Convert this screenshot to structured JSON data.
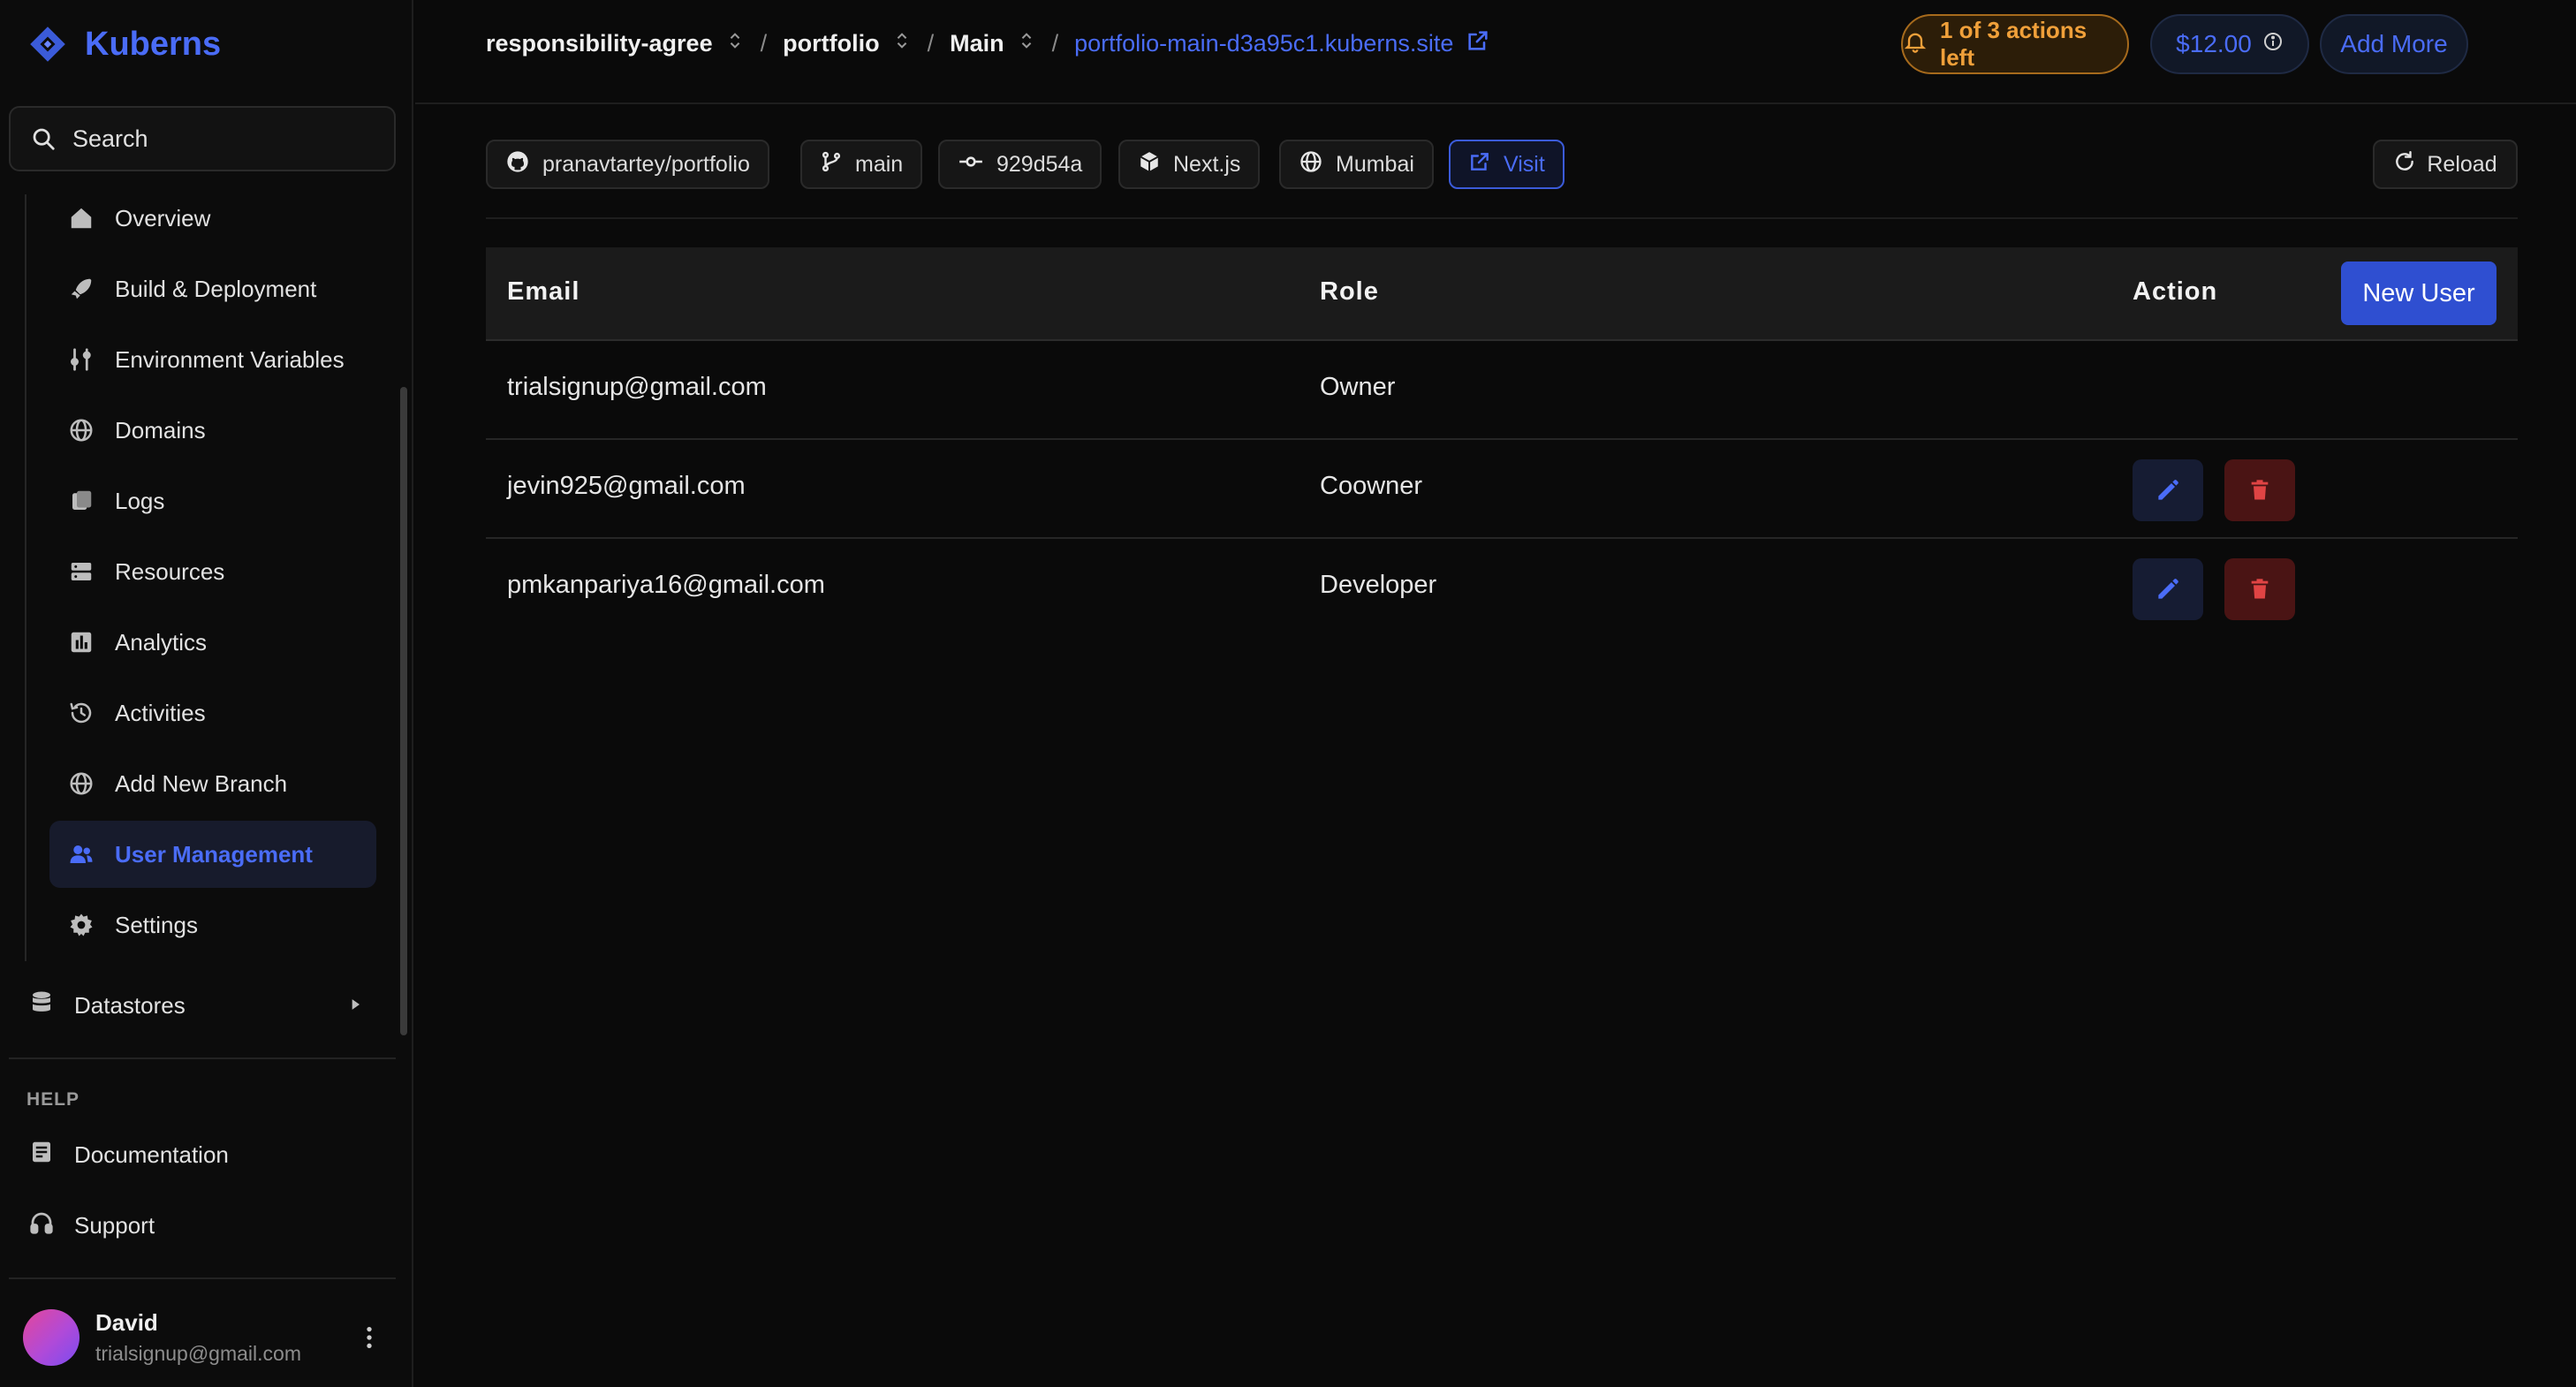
{
  "app": {
    "name": "Kuberns"
  },
  "search": {
    "label": "Search"
  },
  "sidebar": {
    "items": [
      {
        "label": "Overview",
        "icon": "home-icon"
      },
      {
        "label": "Build & Deployment",
        "icon": "rocket-icon"
      },
      {
        "label": "Environment Variables",
        "icon": "sliders-icon"
      },
      {
        "label": "Domains",
        "icon": "globe-icon"
      },
      {
        "label": "Logs",
        "icon": "logs-icon"
      },
      {
        "label": "Resources",
        "icon": "server-icon"
      },
      {
        "label": "Analytics",
        "icon": "bar-chart-icon"
      },
      {
        "label": "Activities",
        "icon": "history-icon"
      },
      {
        "label": "Add New Branch",
        "icon": "globe-icon"
      },
      {
        "label": "User Management",
        "icon": "users-icon",
        "active": true
      },
      {
        "label": "Settings",
        "icon": "gear-icon"
      }
    ],
    "datastores": "Datastores",
    "help_label": "HELP",
    "help_items": [
      {
        "label": "Documentation",
        "icon": "book-icon"
      },
      {
        "label": "Support",
        "icon": "headphones-icon"
      }
    ],
    "user": {
      "name": "David",
      "email": "trialsignup@gmail.com"
    }
  },
  "header": {
    "breadcrumb": [
      "responsibility-agree",
      "portfolio",
      "Main"
    ],
    "site_link": "portfolio-main-d3a95c1.kuberns.site",
    "actions_left": "1 of 3 actions left",
    "price": "$12.00",
    "add_more": "Add More"
  },
  "chips": {
    "repo": "pranavtartey/portfolio",
    "branch": "main",
    "commit": "929d54a",
    "framework": "Next.js",
    "region": "Mumbai",
    "visit": "Visit",
    "reload": "Reload"
  },
  "table": {
    "headers": {
      "email": "Email",
      "role": "Role",
      "action": "Action"
    },
    "new_user": "New User",
    "rows": [
      {
        "email": "trialsignup@gmail.com",
        "role": "Owner"
      },
      {
        "email": "jevin925@gmail.com",
        "role": "Coowner"
      },
      {
        "email": "pmkanpariya16@gmail.com",
        "role": "Developer"
      }
    ]
  },
  "colors": {
    "accent": "#4a6cf7",
    "primary_button": "#2f4fd1",
    "warning": "#f0a03a",
    "danger": "#e04444",
    "background": "#0a0a0a"
  }
}
